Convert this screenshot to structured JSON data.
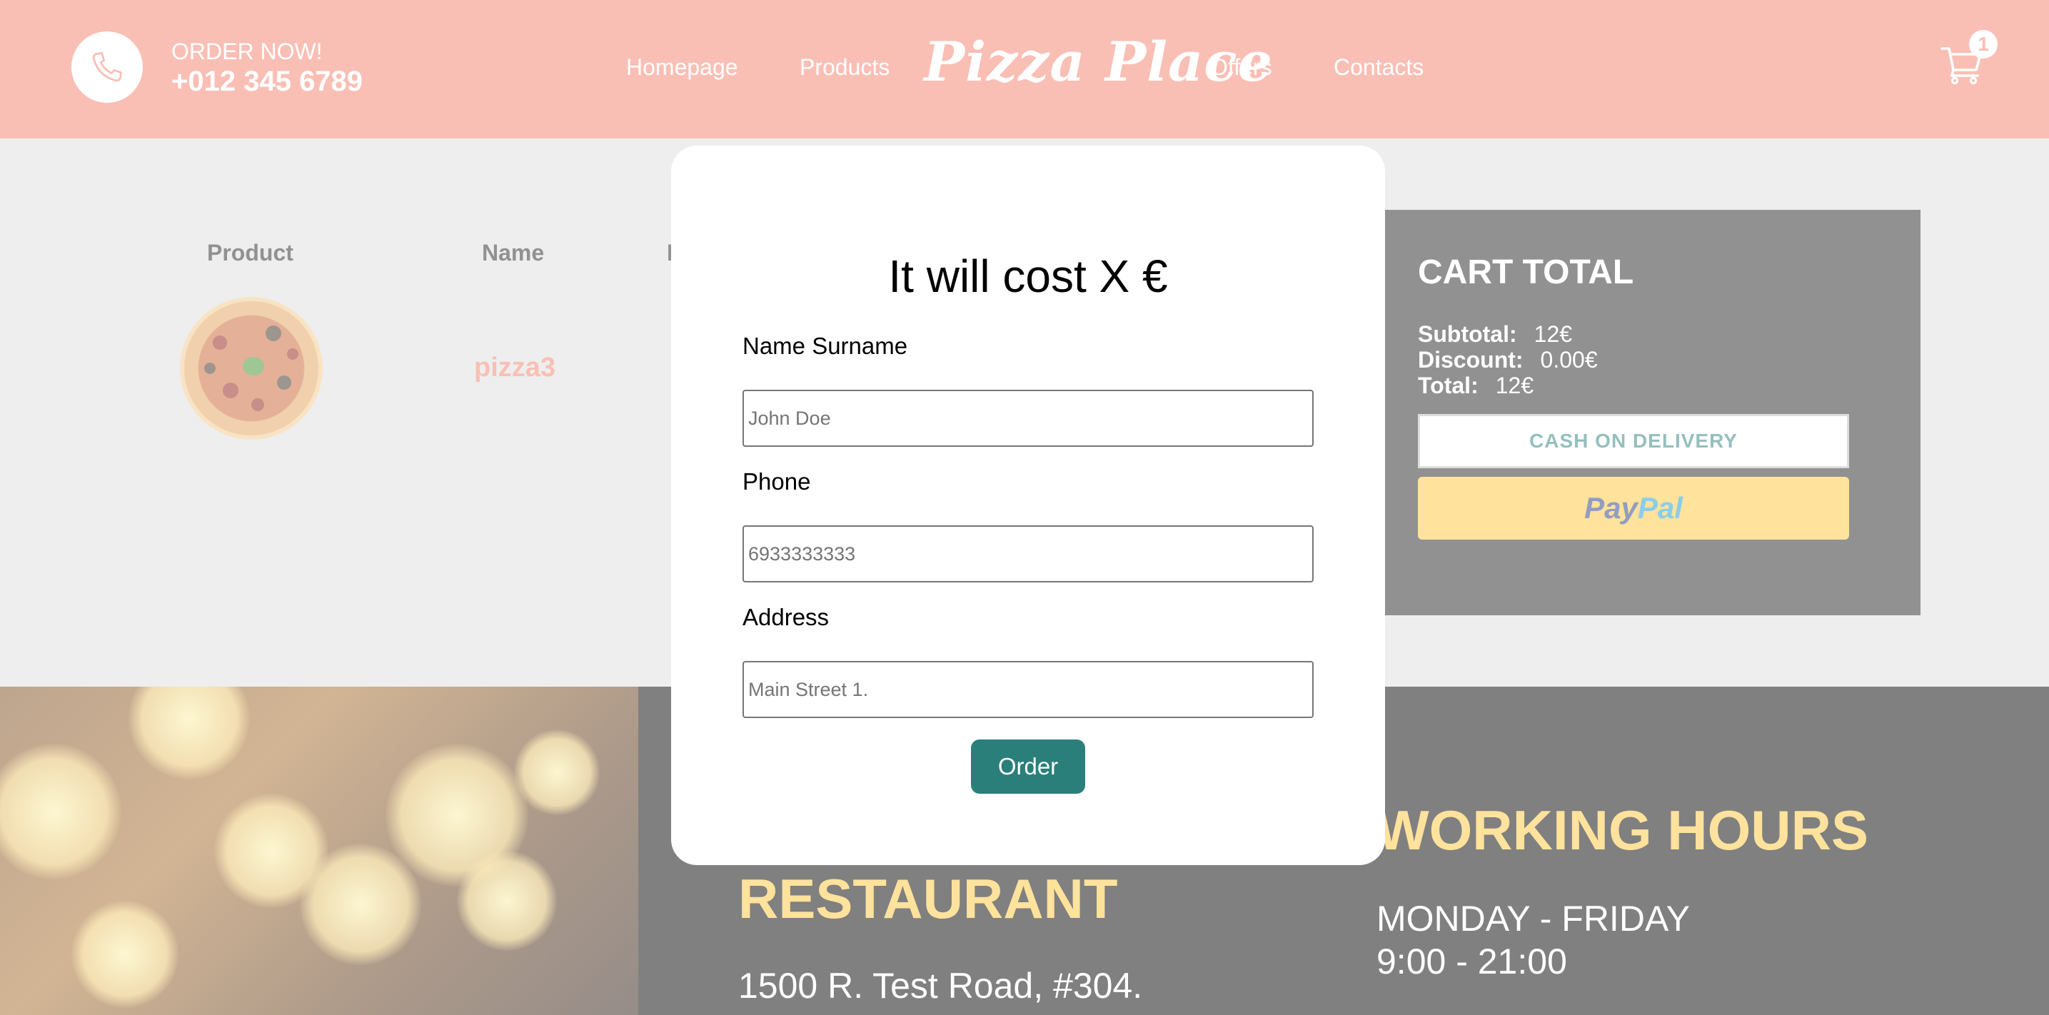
{
  "header": {
    "order_now": "ORDER NOW!",
    "phone": "+012 345 6789",
    "nav": [
      "Homepage",
      "Products",
      "Offers",
      "Contacts"
    ],
    "logo": "Pizza Place",
    "cart_count": "1"
  },
  "cart": {
    "columns": [
      "Product",
      "Name"
    ],
    "partial_column_glyph": "I",
    "items": [
      {
        "name": "pizza3"
      }
    ]
  },
  "cart_total": {
    "title": "CART TOTAL",
    "subtotal_label": "Subtotal:",
    "subtotal_value": "12€",
    "discount_label": "Discount:",
    "discount_value": "0.00€",
    "total_label": "Total:",
    "total_value": "12€",
    "cash_button": "CASH ON DELIVERY",
    "paypal_part1": "Pay",
    "paypal_part2": "Pal"
  },
  "footer": {
    "restaurant_title": "RESTAURANT",
    "address": "1500 R. Test Road, #304.",
    "hours_title": "WORKING HOURS",
    "hours_days": "MONDAY - FRIDAY",
    "hours_time": "9:00 - 21:00"
  },
  "modal": {
    "title": "It will cost X €",
    "name_label": "Name Surname",
    "name_placeholder": "John Doe",
    "phone_label": "Phone",
    "phone_placeholder": "6933333333",
    "address_label": "Address",
    "address_placeholder": "Main Street 1.",
    "order_button": "Order"
  },
  "colors": {
    "header": "#f37f6a",
    "accent_teal": "#2a7f7b",
    "paypal_yellow": "#ffc439",
    "footer_title": "#ffc439"
  },
  "icons": [
    "phone-icon",
    "cart-icon",
    "pizza-image",
    "bokeh-background-image"
  ]
}
